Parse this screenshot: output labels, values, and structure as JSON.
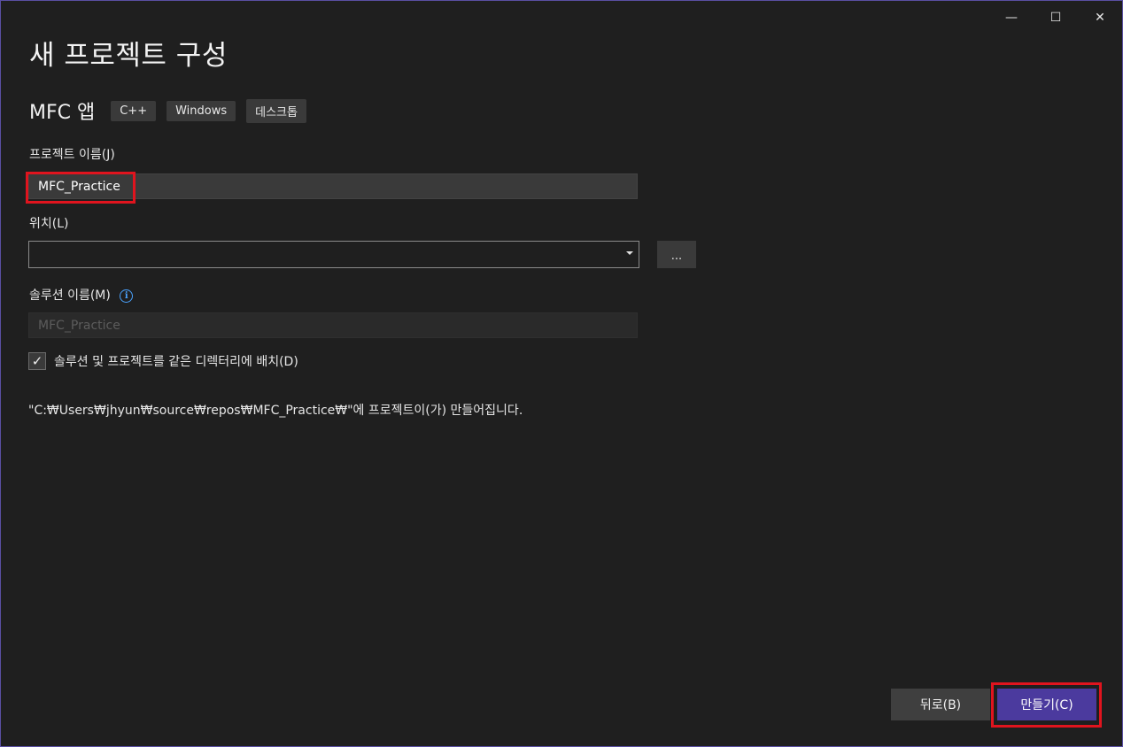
{
  "window": {
    "title": "새 프로젝트 구성",
    "controls": {
      "minimize": "—",
      "maximize": "☐",
      "close": "✕"
    }
  },
  "template": {
    "name": "MFC 앱",
    "tags": [
      "C++",
      "Windows",
      "데스크톱"
    ]
  },
  "project_name": {
    "label": "프로젝트 이름(J)",
    "value": "MFC_Practice"
  },
  "location": {
    "label": "위치(L)",
    "value": "",
    "browse_label": "..."
  },
  "solution_name": {
    "label": "솔루션 이름(M)",
    "placeholder": "MFC_Practice",
    "info_icon": "i"
  },
  "same_directory": {
    "checked": true,
    "check_glyph": "✓",
    "label": "솔루션 및 프로젝트를 같은 디렉터리에 배치(D)"
  },
  "path_note": "\"C:₩Users₩jhyun₩source₩repos₩MFC_Practice₩\"에 프로젝트이(가) 만들어집니다.",
  "footer": {
    "back_label": "뒤로(B)",
    "create_label": "만들기(C)"
  },
  "colors": {
    "accent": "#4b3a9e",
    "highlight": "#e0141e",
    "info": "#4aa3ff"
  }
}
